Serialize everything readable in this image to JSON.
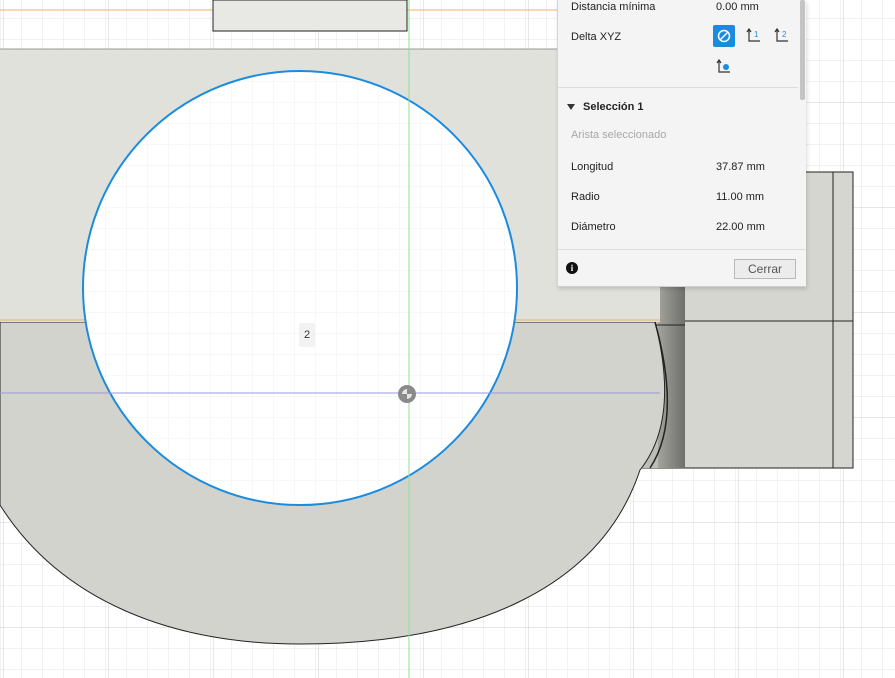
{
  "canvas": {
    "point_marker_label": "2"
  },
  "inspect_panel": {
    "rows": [
      {
        "key": "Distancia mínima",
        "value": "0.00 mm"
      },
      {
        "key": "Delta XYZ",
        "value": ""
      }
    ],
    "delta_icons": [
      "no-delta-icon",
      "delta-axis-1-icon",
      "delta-axis-2-icon",
      "delta-axis-3-icon"
    ],
    "section_title": "Selección 1",
    "selection_hint": "Arista seleccionado",
    "measurements": [
      {
        "key": "Longitud",
        "value": "37.87 mm"
      },
      {
        "key": "Radio",
        "value": "11.00 mm"
      },
      {
        "key": "Diámetro",
        "value": "22.00 mm"
      }
    ],
    "info_glyph": "i",
    "close_label": "Cerrar",
    "accent_color": "#1a8ce0"
  }
}
